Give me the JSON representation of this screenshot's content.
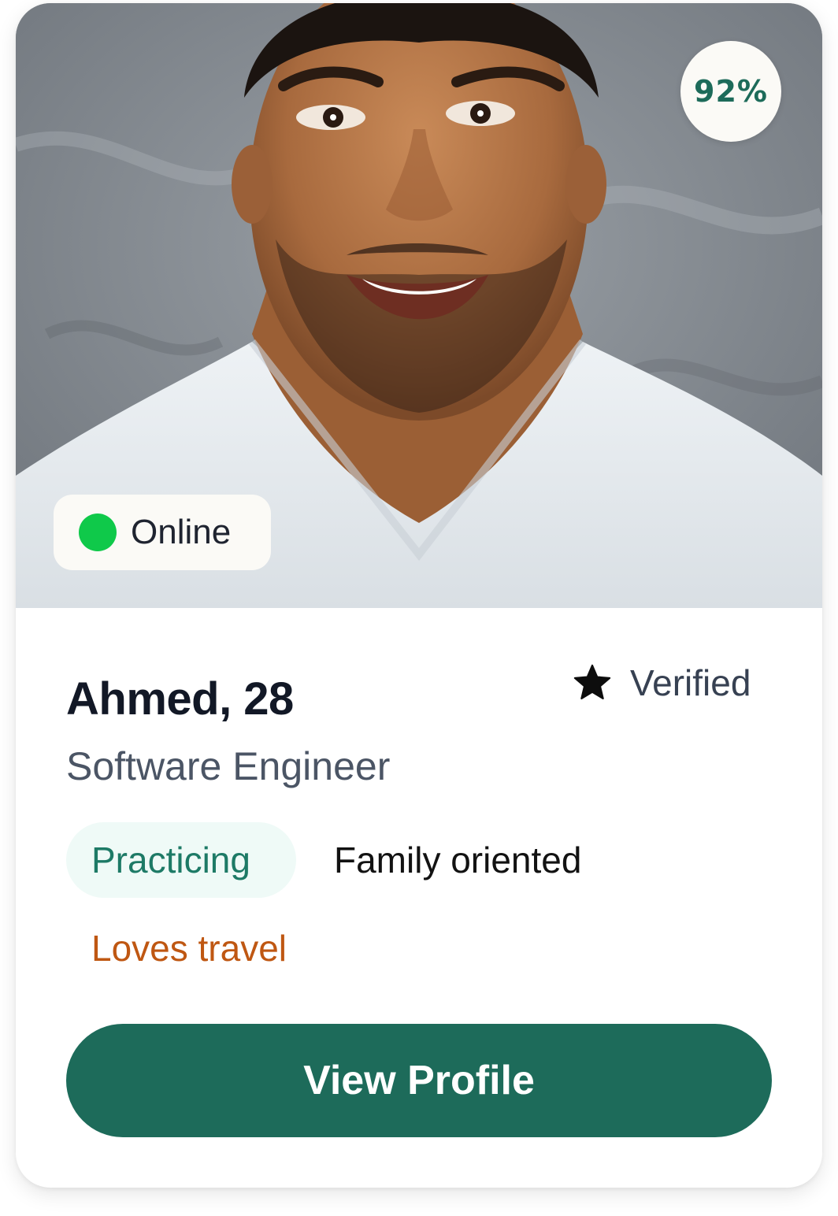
{
  "photo": {
    "match_percent": "92%",
    "status": "Online"
  },
  "profile": {
    "name_age": "Ahmed, 28",
    "verified_label": "Verified",
    "occupation": "Software Engineer"
  },
  "tags": [
    "Practicing",
    "Family oriented",
    "Loves travel"
  ],
  "actions": {
    "view_profile": "View Profile"
  },
  "colors": {
    "brand": "#1d6b5a",
    "online": "#0fc94a",
    "practicing_tag_bg": "#effaf7",
    "practicing_tag_text": "#1d7a66",
    "travel_tag_text": "#bf5712"
  },
  "icons": {
    "verified": "star-icon"
  }
}
